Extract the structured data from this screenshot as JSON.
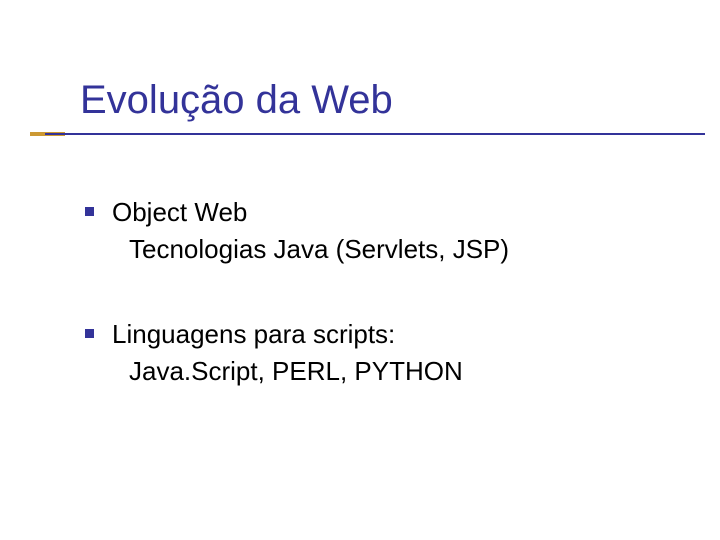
{
  "slide": {
    "title": "Evolução da Web",
    "bullets": [
      {
        "heading": "Object Web",
        "detail": "Tecnologias Java (Servlets, JSP)"
      },
      {
        "heading": "Linguagens para scripts:",
        "detail": "Java.Script, PERL, PYTHON"
      }
    ]
  }
}
